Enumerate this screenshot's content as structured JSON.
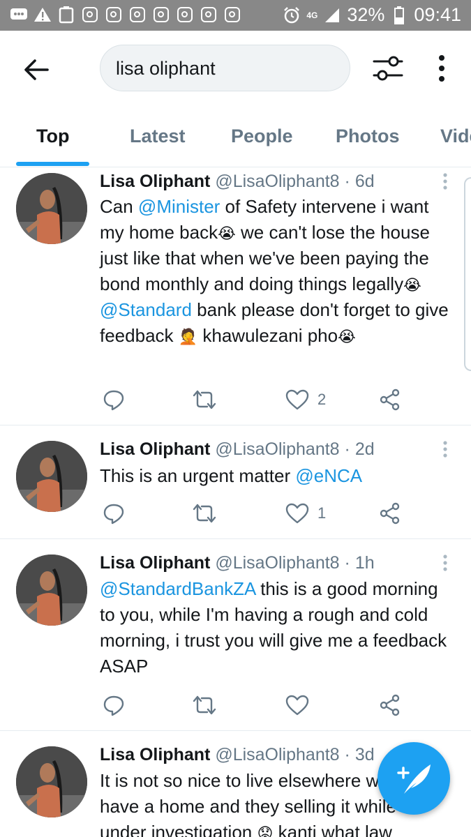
{
  "status_bar": {
    "network": "4G",
    "battery": "32%",
    "time": "09:41"
  },
  "search": {
    "query": "lisa oliphant"
  },
  "tabs": [
    {
      "label": "Top"
    },
    {
      "label": "Latest"
    },
    {
      "label": "People"
    },
    {
      "label": "Photos"
    },
    {
      "label": "Videos"
    }
  ],
  "tweets": [
    {
      "name": "Lisa Oliphant",
      "handle": "@LisaOliphant8",
      "dot": "·",
      "time": "6d",
      "text_parts": [
        {
          "t": "Can ",
          "m": false
        },
        {
          "t": "@Minister",
          "m": true
        },
        {
          "t": " of Safety intervene i want my home back",
          "m": false
        },
        {
          "t": " we can't lose the house just like that when we've been paying the bond monthly and doing things legally",
          "m": false
        },
        {
          "t": "@Standard",
          "m": true
        },
        {
          "t": " bank please don't forget to give feedback ",
          "m": false
        },
        {
          "t": " khawulezani pho",
          "m": false
        }
      ],
      "likes": "2"
    },
    {
      "name": "Lisa Oliphant",
      "handle": "@LisaOliphant8",
      "dot": "·",
      "time": "2d",
      "text_parts": [
        {
          "t": "This is an urgent matter ",
          "m": false
        },
        {
          "t": "@eNCA",
          "m": true
        }
      ],
      "likes": "1"
    },
    {
      "name": "Lisa Oliphant",
      "handle": "@LisaOliphant8",
      "dot": "·",
      "time": "1h",
      "text_parts": [
        {
          "t": "@StandardBankZA",
          "m": true
        },
        {
          "t": " this is a good morning to you, while I'm having a rough and cold morning, i trust you will give me a feedback ASAP",
          "m": false
        }
      ],
      "likes": ""
    },
    {
      "name": "Lisa Oliphant",
      "handle": "@LisaOliphant8",
      "dot": "·",
      "time": "3d",
      "text_parts": [
        {
          "t": "It is not so nice to live elsewhere while you have a home and they selling it while it's under investigation",
          "m": false
        },
        {
          "t": " kanti what law",
          "m": false
        }
      ],
      "likes": ""
    }
  ],
  "icons": {
    "back": "arrow-left-icon",
    "filter": "sliders-icon",
    "more": "more-vertical-icon",
    "reply": "reply-icon",
    "retweet": "retweet-icon",
    "like": "heart-icon",
    "share": "share-icon",
    "compose": "compose-feather-icon"
  },
  "colors": {
    "accent": "#1da1f2",
    "mention": "#1b95e0",
    "secondary_text": "#657786",
    "status_bar": "#888888"
  }
}
